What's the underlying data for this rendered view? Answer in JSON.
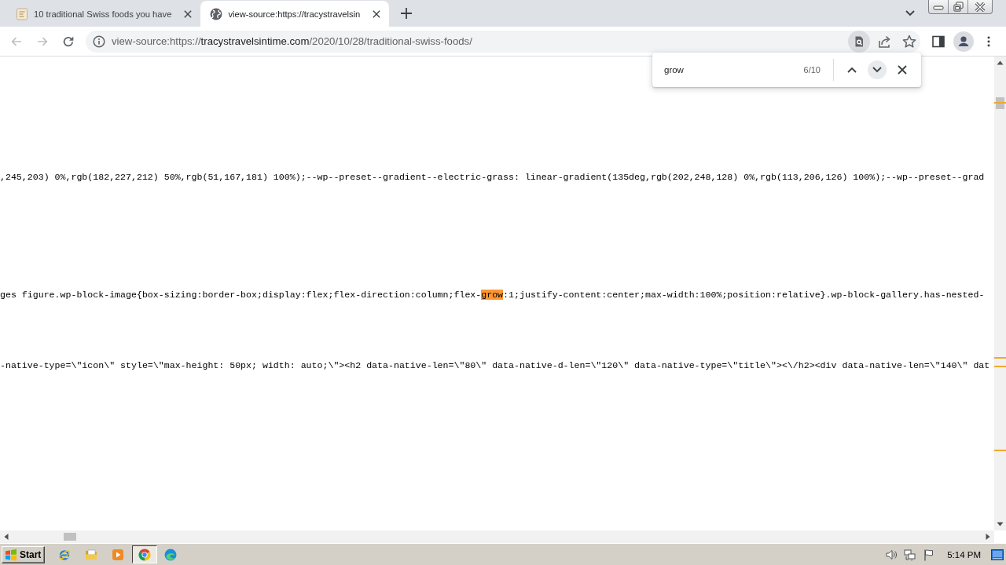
{
  "tabs": [
    {
      "kind": "article",
      "title": "10 traditional Swiss foods you have",
      "selected": false
    },
    {
      "kind": "source",
      "title": "view-source:https://tracystravelsin",
      "selected": true
    }
  ],
  "navigation": {
    "back": {
      "disabled": true
    },
    "forward": {
      "disabled": true
    }
  },
  "address_bar": {
    "scheme": "view-source:https://",
    "host": "tracystravelsintime.com",
    "path": "/2020/10/28/traditional-swiss-foods/"
  },
  "find_bar": {
    "query": "grow",
    "count": "6/10"
  },
  "source_lines": [
    {
      "parts": [
        {
          "text": ",245,203) 0%,rgb(182,227,212) 50%,rgb(51,167,181) 100%);--wp--preset--gradient--electric-grass: linear-gradient(135deg,rgb(202,248,128) 0%,rgb(113,206,126) 100%);--wp--preset--grad",
          "highlighted": false
        }
      ]
    },
    {
      "parts": [
        {
          "text": "ges figure.wp-block-image{box-sizing:border-box;display:flex;flex-direction:column;flex-",
          "highlighted": false
        },
        {
          "text": "grow",
          "highlighted": true
        },
        {
          "text": ":1;justify-content:center;max-width:100%;position:relative}.wp-block-gallery.has-nested-",
          "highlighted": false
        }
      ]
    },
    {
      "parts": [
        {
          "text": "-native-type=\\\"icon\\\" style=\\\"max-height: 50px; width: auto;\\\"><h2 data-native-len=\\\"80\\\" data-native-d-len=\\\"120\\\" data-native-type=\\\"title\\\"><\\/h2><div data-native-len=\\\"140\\\" dat",
          "highlighted": false
        }
      ]
    }
  ],
  "taskbar": {
    "start": "Start",
    "clock": "5:14 PM"
  }
}
